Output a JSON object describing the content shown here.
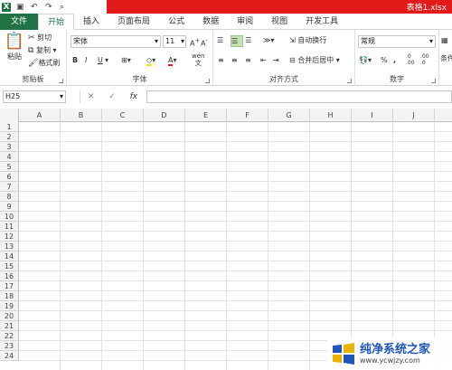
{
  "window": {
    "filename": "表格1.xlsx"
  },
  "tabs": [
    "文件",
    "开始",
    "插入",
    "页面布局",
    "公式",
    "数据",
    "审阅",
    "视图",
    "开发工具"
  ],
  "clipboard": {
    "paste": "粘贴",
    "cut": "剪切",
    "copy": "复制",
    "format_painter": "格式刷",
    "label": "剪贴板"
  },
  "font": {
    "name": "宋体",
    "size": "11",
    "bold": "B",
    "italic": "I",
    "underline": "U",
    "wen": "wén\n文",
    "label": "字体"
  },
  "align": {
    "wrap": "自动换行",
    "merge": "合并后居中",
    "label": "对齐方式"
  },
  "number": {
    "format": "常规",
    "percent": "%",
    "comma": ",",
    "label": "数字",
    "dec_inc": ".0\n.00",
    "dec_dec": ".00\n.0"
  },
  "other": {
    "cond_label": "条件"
  },
  "formula_bar": {
    "name_box": "H25",
    "fx": "fx",
    "cancel": "✕",
    "enter": "✓"
  },
  "columns": [
    "A",
    "B",
    "C",
    "D",
    "E",
    "F",
    "G",
    "H",
    "I",
    "J"
  ],
  "rows": [
    "1",
    "2",
    "3",
    "4",
    "5",
    "6",
    "7",
    "8",
    "9",
    "10",
    "11",
    "12",
    "13",
    "14",
    "15",
    "16",
    "17",
    "18",
    "19",
    "20",
    "21",
    "22",
    "23",
    "24"
  ],
  "watermark": {
    "title": "纯净系统之家",
    "url": "www.ycwjzy.com"
  },
  "colors": {
    "accent": "#217346",
    "title_red": "#e31a1a"
  }
}
